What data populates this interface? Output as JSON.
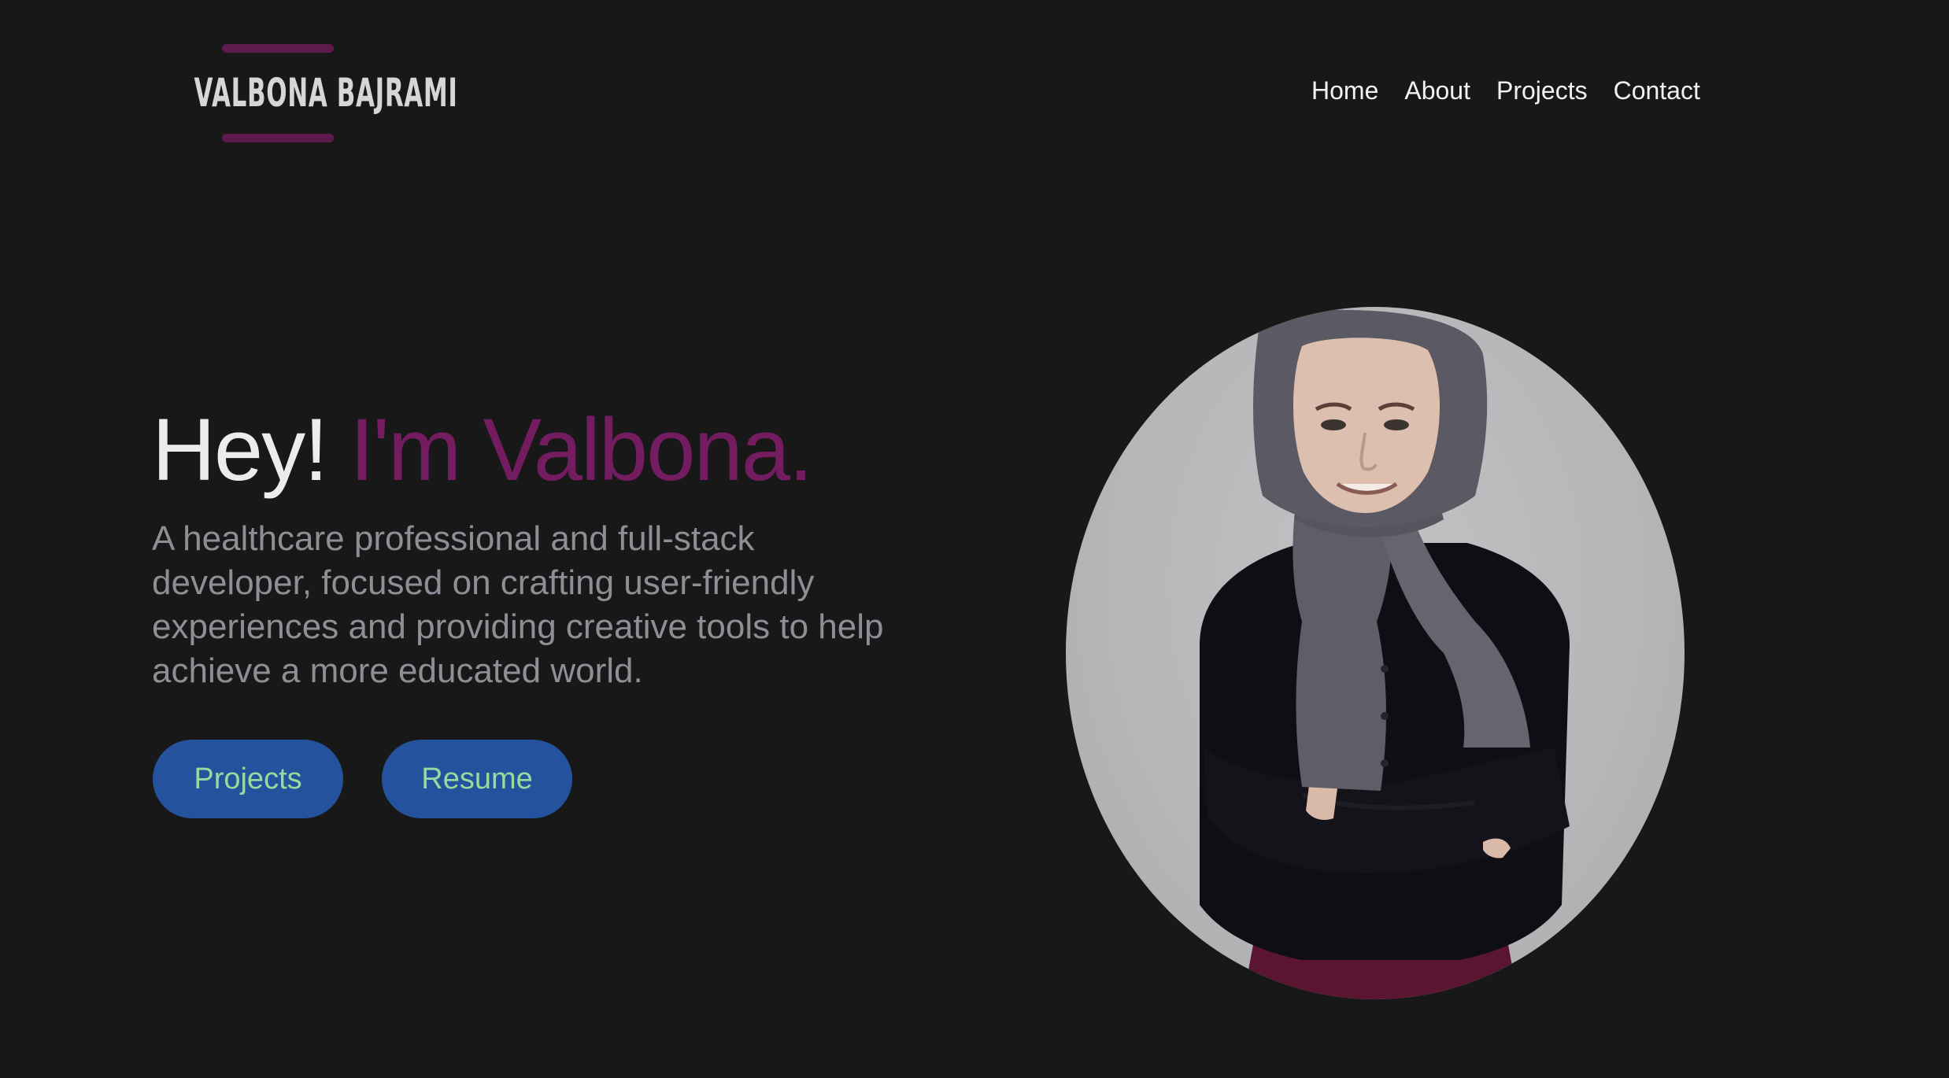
{
  "logo": {
    "text": "VALBONA BAJRAMI",
    "accent_color": "#5e1a4d"
  },
  "nav": {
    "items": [
      {
        "label": "Home"
      },
      {
        "label": "About"
      },
      {
        "label": "Projects"
      },
      {
        "label": "Contact"
      }
    ]
  },
  "hero": {
    "greeting": "Hey!",
    "name_line": "I'm Valbona.",
    "name_color": "#741c60",
    "description": "A healthcare professional and full-stack developer, focused on crafting user-friendly experiences and providing creative tools to help achieve a more educated world.",
    "buttons": [
      {
        "label": "Projects"
      },
      {
        "label": "Resume"
      }
    ]
  },
  "colors": {
    "background": "#181818",
    "button_bg": "#24529c",
    "button_text": "#94dba0"
  },
  "portrait": {
    "icon": "profile-photo"
  }
}
